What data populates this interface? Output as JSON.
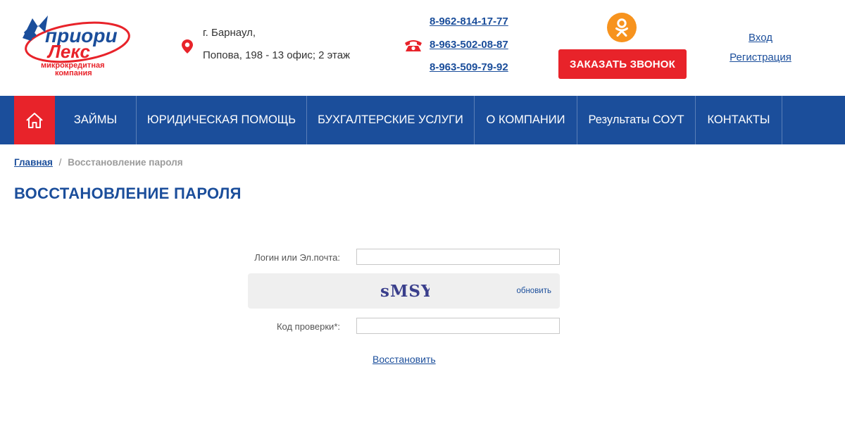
{
  "colors": {
    "brand_blue": "#1b4e9b",
    "accent_red": "#e8232a",
    "ok_orange": "#f7931e",
    "captcha_bg": "#efefef"
  },
  "logo": {
    "line1": "приори",
    "line2": "Лекс",
    "subtitle1": "микрокредитная",
    "subtitle2": "компания"
  },
  "address": {
    "icon": "map-pin-icon",
    "city": "г. Барнаул,",
    "street": "Попова, 198 - 13 офис; 2 этаж"
  },
  "phones": {
    "icon": "phone-icon",
    "numbers": [
      "8-962-814-17-77",
      "8-963-502-08-87 ",
      "8-963-509-79-92 "
    ]
  },
  "social": {
    "icon": "odnoklassniki-icon"
  },
  "callback_button": "ЗАКАЗАТЬ ЗВОНОК",
  "auth": {
    "login": "Вход",
    "register": "Регистрация"
  },
  "nav": {
    "home_icon": "home-icon",
    "items": [
      "ЗАЙМЫ",
      "ЮРИДИЧЕСКАЯ ПОМОЩЬ",
      "БУХГАЛТЕРСКИЕ УСЛУГИ",
      "О КОМПАНИИ",
      "Результаты СОУТ",
      "КОНТАКТЫ"
    ]
  },
  "breadcrumb": {
    "home": "Главная",
    "separator": "/",
    "current": "Восстановление пароля"
  },
  "page_title": "ВОССТАНОВЛЕНИЕ ПАРОЛЯ",
  "form": {
    "login_label": "Логин или Эл.почта:",
    "login_value": "",
    "captcha_text": "sMSY",
    "captcha_refresh": "обновить",
    "code_label": "Код проверки*:",
    "code_value": "",
    "submit": "Восстановить"
  }
}
